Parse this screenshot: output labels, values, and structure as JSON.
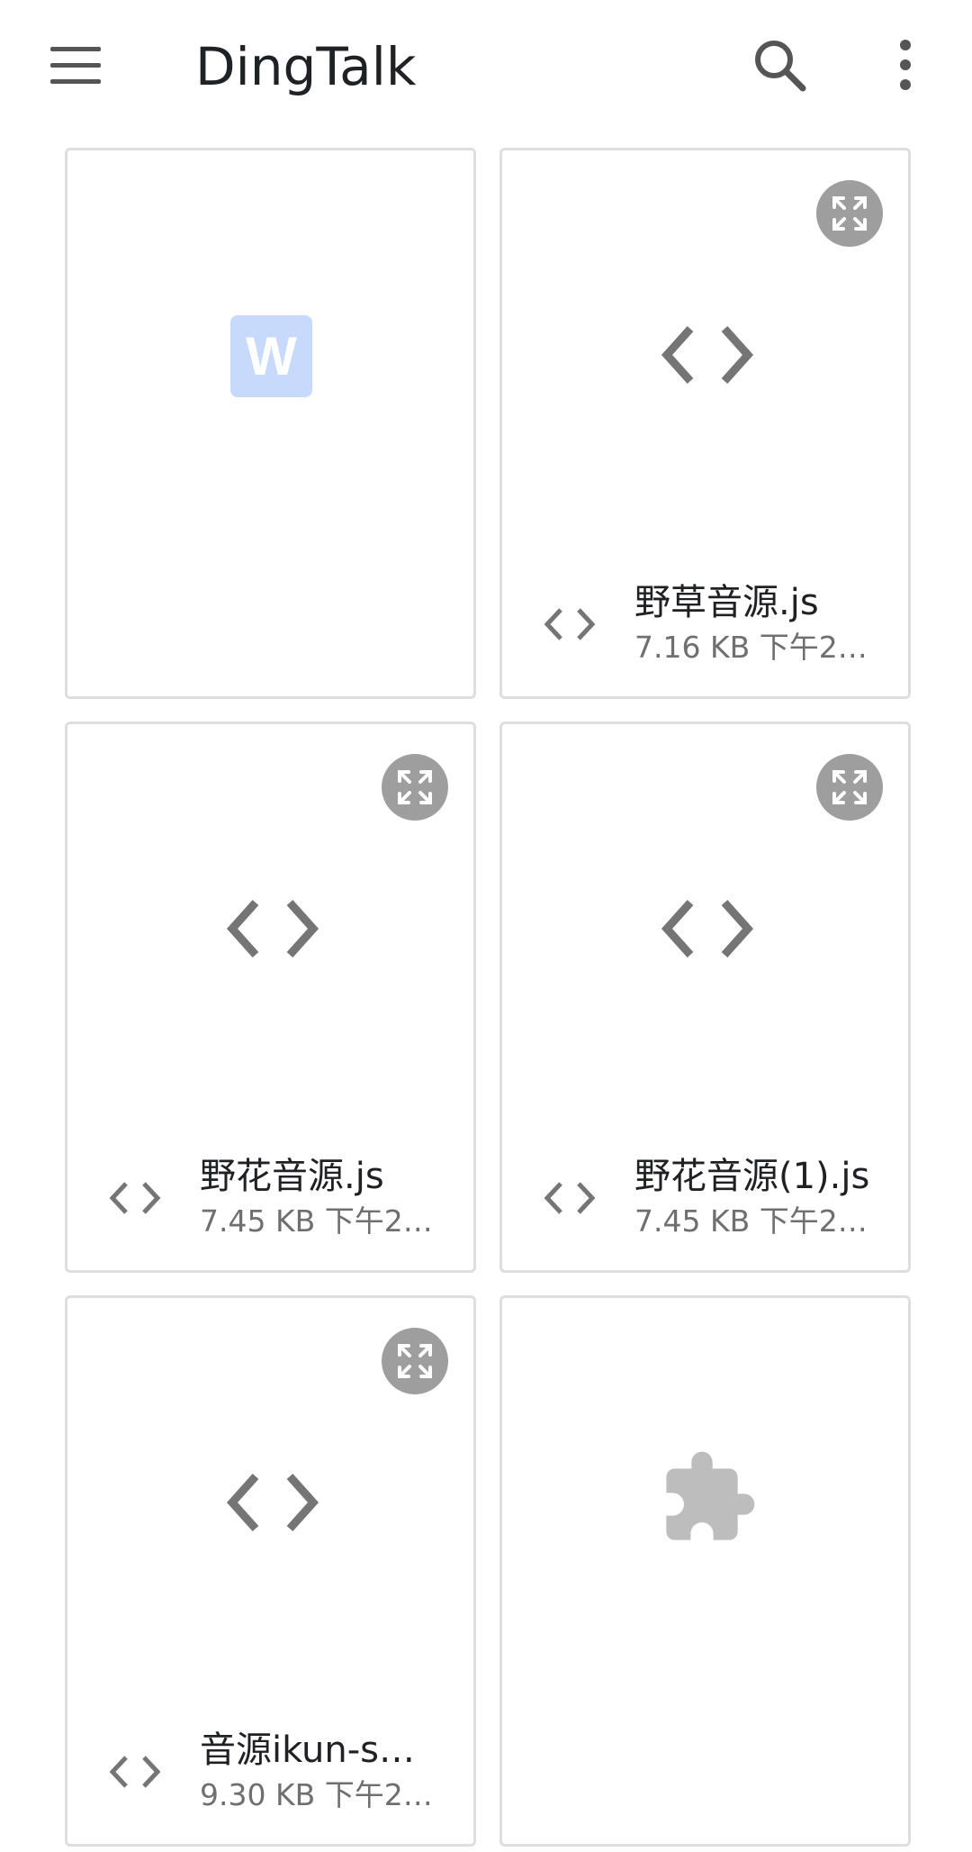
{
  "app": {
    "title": "DingTalk"
  },
  "files": [
    {
      "kind": "document",
      "thumb_letter": "W",
      "thumb_color": "#c7dafb"
    },
    {
      "kind": "code",
      "name": "野草音源.js",
      "meta": "7.16 KB 下午2…"
    },
    {
      "kind": "code",
      "name": "野花音源.js",
      "meta": "7.45 KB 下午2…"
    },
    {
      "kind": "code",
      "name": "野花音源(1).js",
      "meta": "7.45 KB 下午2…"
    },
    {
      "kind": "code",
      "name": "音源ikun-s…",
      "meta": "9.30 KB 下午2…"
    },
    {
      "kind": "extension",
      "thumb_icon": "puzzle-icon"
    }
  ],
  "icons": {
    "menu": "menu-icon",
    "search": "search-icon",
    "more": "more-vert-icon",
    "expand": "expand-icon",
    "code": "code-icon"
  },
  "colors": {
    "icon_gray": "#757575",
    "expand_bg": "#9e9e9e",
    "puzzle": "#bdbdbd"
  }
}
